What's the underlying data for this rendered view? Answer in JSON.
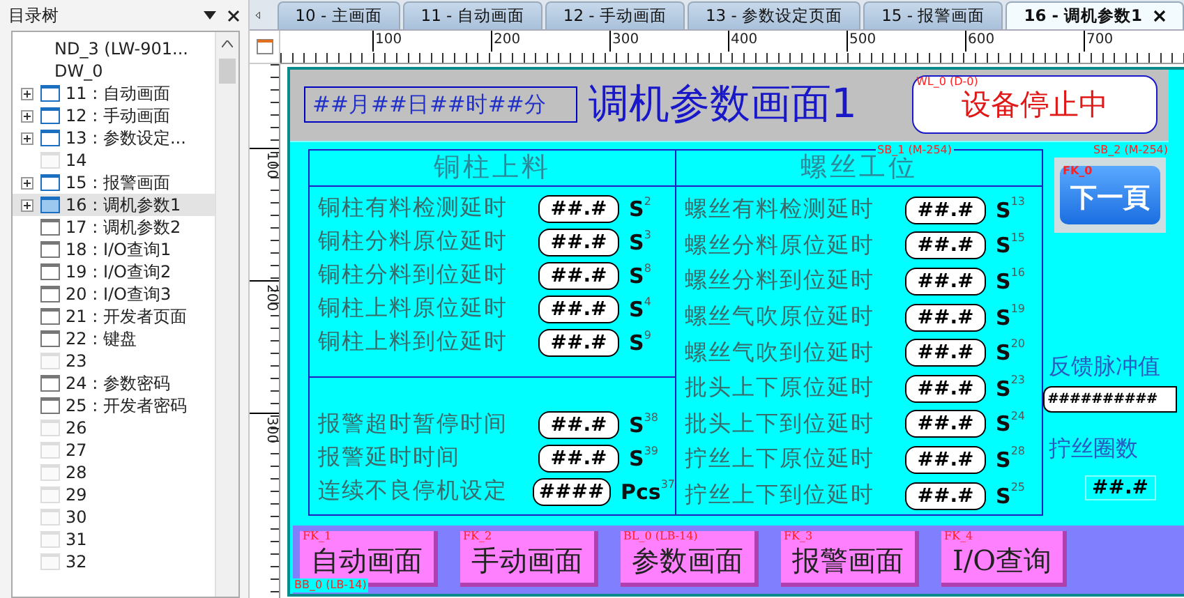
{
  "sidebar": {
    "title": "目录树",
    "items": [
      {
        "label": "ND_3 (LW-901...",
        "kind": "sub",
        "selected": false
      },
      {
        "label": "DW_0",
        "kind": "sub",
        "selected": false
      },
      {
        "label": "11 : 自动画面",
        "kind": "open",
        "expandable": true,
        "selected": false
      },
      {
        "label": "12 : 手动画面",
        "kind": "open",
        "expandable": true,
        "selected": false
      },
      {
        "label": "13 : 参数设定...",
        "kind": "open",
        "expandable": true,
        "selected": false
      },
      {
        "label": "14",
        "kind": "empty",
        "expandable": false,
        "selected": false
      },
      {
        "label": "15 : 报警画面",
        "kind": "open",
        "expandable": true,
        "selected": false
      },
      {
        "label": "16 : 调机参数1",
        "kind": "open",
        "expandable": true,
        "selected": true
      },
      {
        "label": "17 : 调机参数2",
        "kind": "used",
        "expandable": false,
        "selected": false
      },
      {
        "label": "18 : I/O查询1",
        "kind": "used",
        "expandable": false,
        "selected": false
      },
      {
        "label": "19 : I/O查询2",
        "kind": "used",
        "expandable": false,
        "selected": false
      },
      {
        "label": "20 : I/O查询3",
        "kind": "used",
        "expandable": false,
        "selected": false
      },
      {
        "label": "21 : 开发者页面",
        "kind": "used",
        "expandable": false,
        "selected": false
      },
      {
        "label": "22 : 键盘",
        "kind": "used",
        "expandable": false,
        "selected": false
      },
      {
        "label": "23",
        "kind": "empty",
        "expandable": false,
        "selected": false
      },
      {
        "label": "24 : 参数密码",
        "kind": "used",
        "expandable": false,
        "selected": false
      },
      {
        "label": "25 : 开发者密码",
        "kind": "used",
        "expandable": false,
        "selected": false
      },
      {
        "label": "26",
        "kind": "empty",
        "expandable": false,
        "selected": false
      },
      {
        "label": "27",
        "kind": "empty",
        "expandable": false,
        "selected": false
      },
      {
        "label": "28",
        "kind": "empty",
        "expandable": false,
        "selected": false
      },
      {
        "label": "29",
        "kind": "empty",
        "expandable": false,
        "selected": false
      },
      {
        "label": "30",
        "kind": "empty",
        "expandable": false,
        "selected": false
      },
      {
        "label": "31",
        "kind": "empty",
        "expandable": false,
        "selected": false
      },
      {
        "label": "32",
        "kind": "empty",
        "expandable": false,
        "selected": false
      }
    ]
  },
  "tabs": [
    {
      "label": "10 - 主画面",
      "selected": false
    },
    {
      "label": "11 - 自动画面",
      "selected": false
    },
    {
      "label": "12 - 手动画面",
      "selected": false
    },
    {
      "label": "13 - 参数设定页面",
      "selected": false
    },
    {
      "label": "15 - 报警画面",
      "selected": false
    },
    {
      "label": "16 - 调机参数1",
      "selected": true
    }
  ],
  "ruler": {
    "horizontal": [
      "100",
      "200",
      "300",
      "400",
      "500",
      "600",
      "700"
    ],
    "vertical": [
      "100",
      "200",
      "300"
    ]
  },
  "screen": {
    "datetime": "##月##日##时##分",
    "title": "调机参数画面1",
    "status": {
      "tag": "WL_0 (D-0)",
      "text": "设备停止中"
    },
    "section_tags": [
      "SB_1 (M-254)",
      "SB_2 (M-254)"
    ],
    "sections": [
      {
        "title": "铜柱上料",
        "groups": [
          [
            {
              "label": "铜柱有料检测延时",
              "value": "##.#",
              "unit": "S",
              "index": "2"
            },
            {
              "label": "铜柱分料原位延时",
              "value": "##.#",
              "unit": "S",
              "index": "3"
            },
            {
              "label": "铜柱分料到位延时",
              "value": "##.#",
              "unit": "S",
              "index": "8"
            },
            {
              "label": "铜柱上料原位延时",
              "value": "##.#",
              "unit": "S",
              "index": "4"
            },
            {
              "label": "铜柱上料到位延时",
              "value": "##.#",
              "unit": "S",
              "index": "9"
            }
          ],
          [
            {
              "label": "报警超时暂停时间",
              "value": "##.#",
              "unit": "S",
              "index": "38"
            },
            {
              "label": "报警延时时间",
              "value": "##.#",
              "unit": "S",
              "index": "39"
            },
            {
              "label": "连续不良停机设定",
              "value": "####",
              "unit": "Pcs",
              "index": "37"
            }
          ]
        ]
      },
      {
        "title": "螺丝工位",
        "groups": [
          [
            {
              "label": "螺丝有料检测延时",
              "value": "##.#",
              "unit": "S",
              "index": "13"
            },
            {
              "label": "螺丝分料原位延时",
              "value": "##.#",
              "unit": "S",
              "index": "15"
            },
            {
              "label": "螺丝分料到位延时",
              "value": "##.#",
              "unit": "S",
              "index": "16"
            },
            {
              "label": "螺丝气吹原位延时",
              "value": "##.#",
              "unit": "S",
              "index": "19"
            },
            {
              "label": "螺丝气吹到位延时",
              "value": "##.#",
              "unit": "S",
              "index": "20"
            },
            {
              "label": "批头上下原位延时",
              "value": "##.#",
              "unit": "S",
              "index": "23"
            },
            {
              "label": "批头上下到位延时",
              "value": "##.#",
              "unit": "S",
              "index": "24"
            },
            {
              "label": "拧丝上下原位延时",
              "value": "##.#",
              "unit": "S",
              "index": "28"
            },
            {
              "label": "拧丝上下到位延时",
              "value": "##.#",
              "unit": "S",
              "index": "25"
            }
          ]
        ]
      }
    ],
    "next_button": {
      "tag": "FK_0",
      "label": "下一頁"
    },
    "feedback": {
      "label": "反馈脉冲值",
      "value": "##########"
    },
    "turns": {
      "label": "拧丝圈数",
      "value": "##.#"
    },
    "bar_tag": "BB_0 (LB-14)",
    "nav_buttons": [
      {
        "tag": "FK_1",
        "label": "自动画面"
      },
      {
        "tag": "FK_2",
        "label": "手动画面"
      },
      {
        "tag": "BL_0 (LB-14)",
        "label": "参数画面"
      },
      {
        "tag": "FK_3",
        "label": "报警画面"
      },
      {
        "tag": "FK_4",
        "label": "I/O查询"
      }
    ]
  }
}
